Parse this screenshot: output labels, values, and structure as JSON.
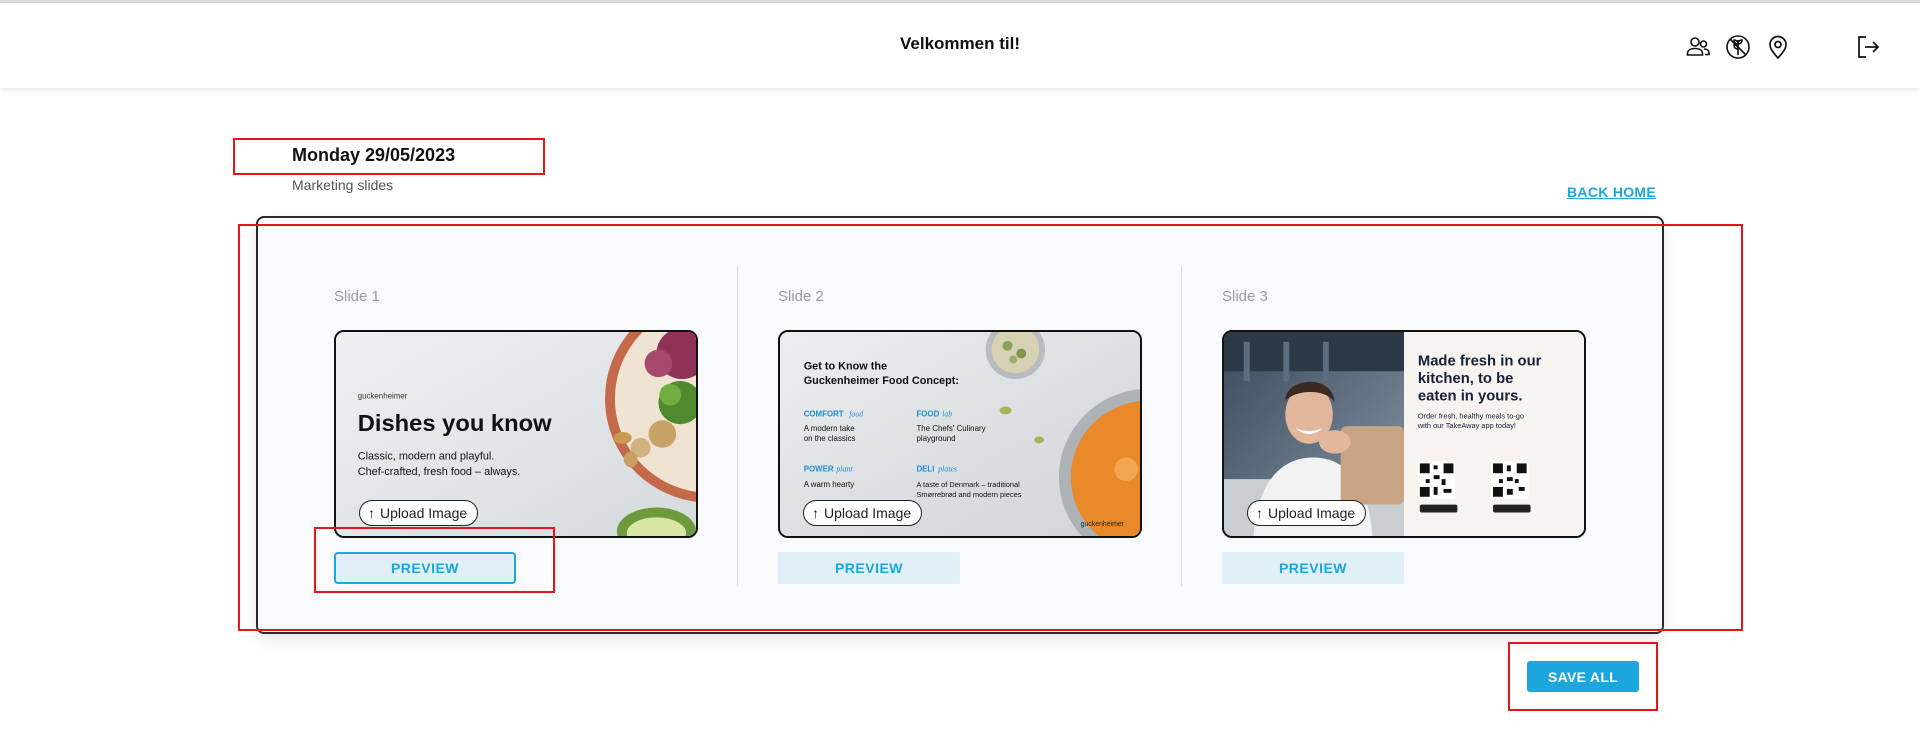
{
  "header": {
    "title": "Velkommen til!",
    "icons": [
      "users-icon",
      "no-gluten-icon",
      "location-pin-icon",
      "logout-icon"
    ]
  },
  "page": {
    "date": "Monday 29/05/2023",
    "subtitle": "Marketing slides",
    "back_home": "BACK HOME"
  },
  "slides": [
    {
      "label": "Slide 1",
      "upload_label": "Upload Image",
      "preview_label": "PREVIEW",
      "image": {
        "brand": "guckenheimer",
        "headline": "Dishes you know",
        "line1": "Classic, modern and playful.",
        "line2": "Chef-crafted, fresh food – always."
      }
    },
    {
      "label": "Slide 2",
      "upload_label": "Upload Image",
      "preview_label": "PREVIEW",
      "image": {
        "headline1": "Get to Know the",
        "headline2": "Guckenheimer Food Concept:",
        "c1_title": "COMFORT",
        "c1_tag": "food",
        "c1_line1": "A modern take",
        "c1_line2": "on the classics",
        "c2_title": "FOOD",
        "c2_tag": "lab",
        "c2_line1": "The Chefs' Culinary",
        "c2_line2": "playground",
        "c3_title": "POWER",
        "c3_tag": "plant",
        "c3_line1": "A warm hearty",
        "c4_title": "DELI",
        "c4_tag": "plates",
        "c4_line1": "A taste of Denmark – traditional",
        "c4_line2": "Smørrebrød and modern pieces",
        "brand": "guckenheimer"
      }
    },
    {
      "label": "Slide 3",
      "upload_label": "Upload Image",
      "preview_label": "PREVIEW",
      "image": {
        "headline1": "Made fresh in our",
        "headline2": "kitchen, to be",
        "headline3": "eaten in yours.",
        "line1": "Order fresh, healthy meals to-go",
        "line2": "with our TakeAway app today!"
      }
    }
  ],
  "actions": {
    "save_all": "SAVE ALL"
  },
  "colors": {
    "accent": "#1ba6dd",
    "accent_light": "#e1f0f7",
    "highlight": "#e8141b",
    "panel_bg": "#f9fafb"
  }
}
